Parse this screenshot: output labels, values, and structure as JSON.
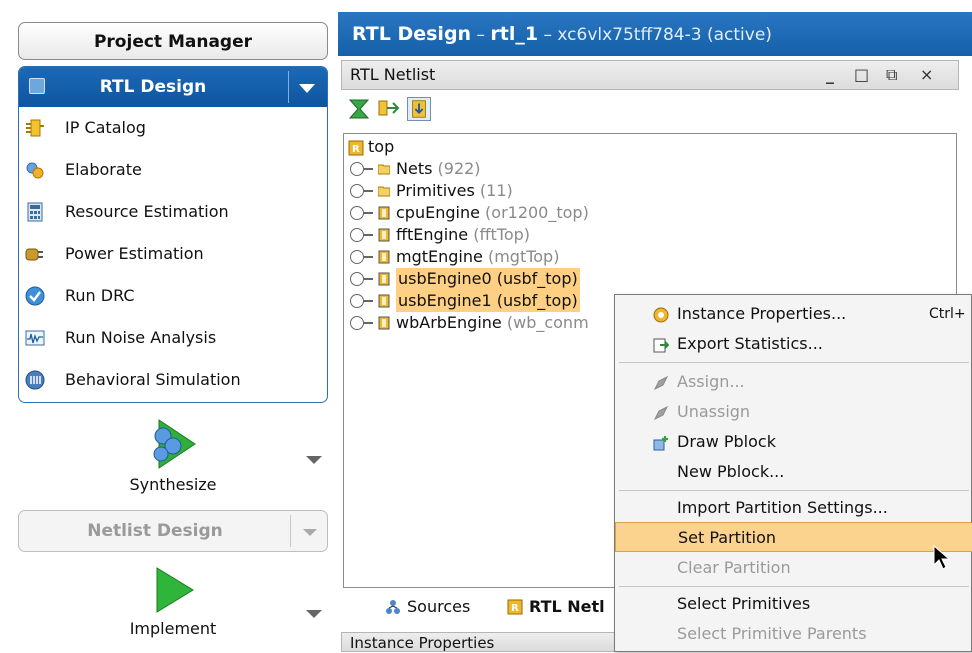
{
  "flow": {
    "project_manager": "Project Manager",
    "rtl_design": "RTL Design",
    "items": [
      {
        "label": "IP Catalog",
        "icon": "ip-catalog-icon"
      },
      {
        "label": "Elaborate",
        "icon": "elaborate-icon"
      },
      {
        "label": "Resource Estimation",
        "icon": "resource-estimation-icon"
      },
      {
        "label": "Power Estimation",
        "icon": "power-estimation-icon"
      },
      {
        "label": "Run DRC",
        "icon": "run-drc-icon"
      },
      {
        "label": "Run Noise Analysis",
        "icon": "noise-analysis-icon"
      },
      {
        "label": "Behavioral Simulation",
        "icon": "behavioral-simulation-icon"
      }
    ],
    "synthesize": "Synthesize",
    "netlist_design": "Netlist Design",
    "implement": "Implement"
  },
  "title": {
    "main": "RTL Design",
    "sep1": " – ",
    "design": "rtl_1",
    "sep2": " – ",
    "part": "xc6vlx75tff784-3 (active)"
  },
  "panel": {
    "title": "RTL Netlist",
    "controls": [
      "_",
      "□",
      "⧉",
      "×"
    ]
  },
  "tree": {
    "root": "top",
    "nodes": [
      {
        "name": "Nets",
        "detail": "(922)",
        "type": "folder",
        "selected": false
      },
      {
        "name": "Primitives",
        "detail": "(11)",
        "type": "folder",
        "selected": false
      },
      {
        "name": "cpuEngine",
        "detail": "(or1200_top)",
        "type": "module",
        "selected": false
      },
      {
        "name": "fftEngine",
        "detail": "(fftTop)",
        "type": "module",
        "selected": false
      },
      {
        "name": "mgtEngine",
        "detail": "(mgtTop)",
        "type": "module",
        "selected": false
      },
      {
        "name": "usbEngine0",
        "detail": "(usbf_top)",
        "type": "module",
        "selected": true
      },
      {
        "name": "usbEngine1",
        "detail": "(usbf_top)",
        "type": "module",
        "selected": true
      },
      {
        "name": "wbArbEngine",
        "detail": "(wb_conm",
        "type": "module",
        "selected": false
      }
    ]
  },
  "tabs": [
    {
      "label": "Sources",
      "icon": "sources-icon"
    },
    {
      "label": "RTL Netl",
      "icon": "rtl-netlist-icon"
    }
  ],
  "bottom_panel": "Instance Properties",
  "menu": {
    "items": [
      {
        "label": "Instance Properties...",
        "shortcut": "Ctrl+",
        "icon": "properties-icon",
        "disabled": false
      },
      {
        "label": "Export Statistics...",
        "icon": "export-icon",
        "disabled": false
      },
      {
        "label": "Assign...",
        "icon": "assign-icon",
        "disabled": true
      },
      {
        "label": "Unassign",
        "icon": "unassign-icon",
        "disabled": true
      },
      {
        "label": "Draw Pblock",
        "icon": "draw-pblock-icon",
        "disabled": false
      },
      {
        "label": "New Pblock...",
        "disabled": false
      },
      {
        "label": "Import Partition Settings...",
        "disabled": false
      },
      {
        "label": "Set Partition",
        "disabled": false,
        "highlighted": true
      },
      {
        "label": "Clear Partition",
        "disabled": true
      },
      {
        "label": "Select Primitives",
        "disabled": false
      },
      {
        "label": "Select Primitive Parents",
        "disabled": true
      }
    ]
  },
  "colors": {
    "header_blue": "#1560a8",
    "selection_orange": "#ffd083",
    "menu_highlight": "#fcd38e"
  }
}
